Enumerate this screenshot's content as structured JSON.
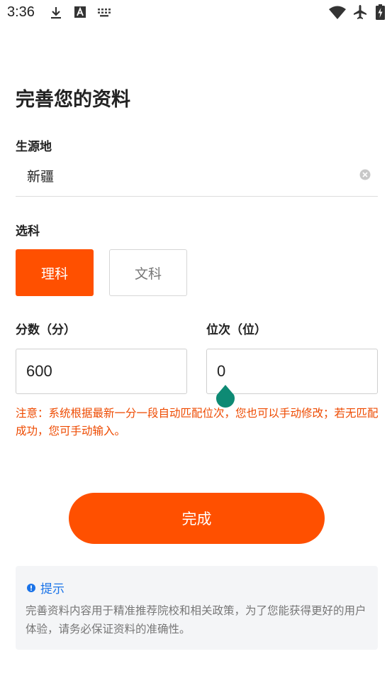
{
  "status_bar": {
    "time": "3:36"
  },
  "page": {
    "title": "完善您的资料"
  },
  "origin": {
    "label": "生源地",
    "value": "新疆"
  },
  "subject": {
    "label": "选科",
    "options": [
      "理科",
      "文科"
    ],
    "selected": "理科"
  },
  "score": {
    "label": "分数（分）",
    "value": "600"
  },
  "rank": {
    "label": "位次（位）",
    "value": "0"
  },
  "note": "注意：系统根据最新一分一段自动匹配位次，您也可以手动修改；若无匹配成功，您可手动输入。",
  "submit_label": "完成",
  "tip": {
    "title": "提示",
    "text": "完善资料内容用于精准推荐院校和相关政策，为了您能获得更好的用户体验，请务必保证资料的准确性。"
  },
  "colors": {
    "accent": "#ff5000",
    "note_text": "#ee4a00",
    "tip_blue": "#1a73e8",
    "cursor_handle": "#0e8a74"
  }
}
